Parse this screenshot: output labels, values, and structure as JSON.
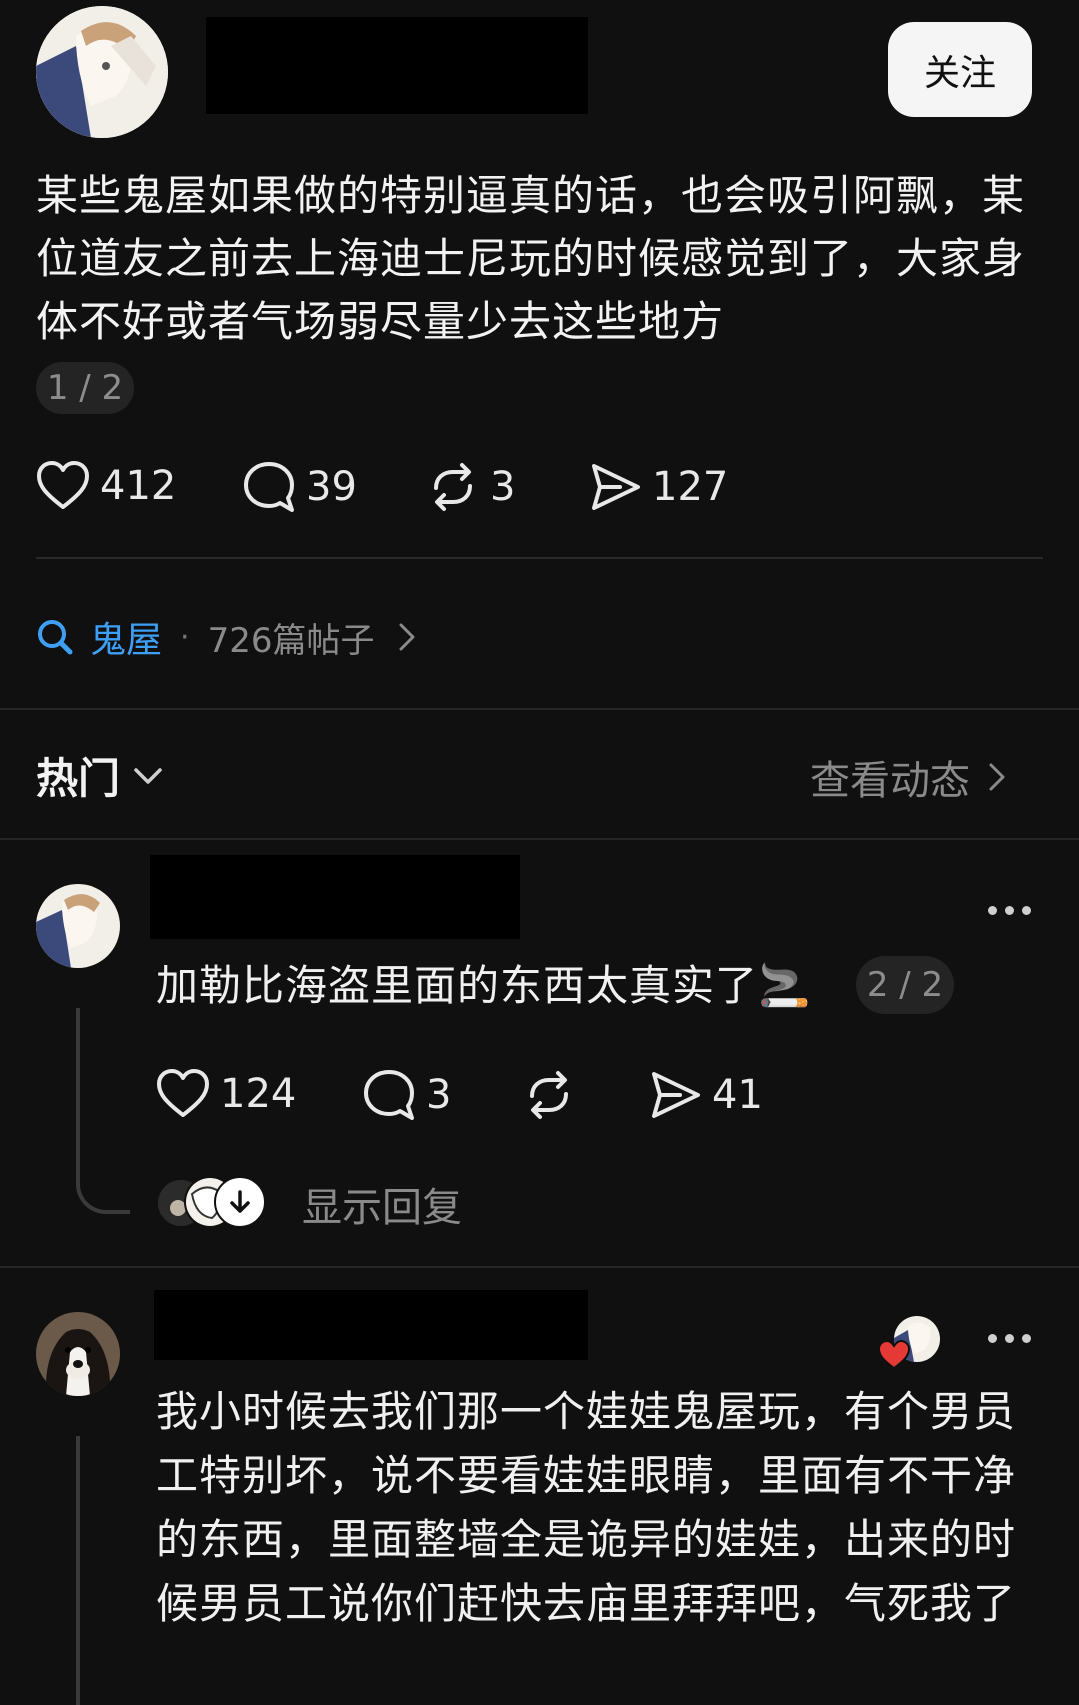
{
  "post": {
    "follow_label": "关注",
    "text": "某些鬼屋如果做的特别逼真的话，也会吸引阿飘，某位道友之前去上海迪士尼玩的时候感觉到了，大家身体不好或者气场弱尽量少去这些地方",
    "page_indicator": "1 / 2",
    "likes": "412",
    "comments": "39",
    "reposts": "3",
    "shares": "127"
  },
  "topic": {
    "name": "鬼屋",
    "separator": "·",
    "count": "726篇帖子"
  },
  "comments_header": {
    "sort_label": "热门",
    "view_activity": "查看动态"
  },
  "comments": [
    {
      "text": "加勒比海盗里面的东西太真实了🚬",
      "page_indicator": "2 / 2",
      "likes": "124",
      "comments": "3",
      "shares": "41",
      "show_replies": "显示回复"
    },
    {
      "text": "我小时候去我们那一个娃娃鬼屋玩，有个男员工特别坏，说不要看娃娃眼睛，里面有不干净的东西，里面整墙全是诡异的娃娃，出来的时候男员工说你们赶快去庙里拜拜吧，气死我了"
    }
  ],
  "colors": {
    "background": "#101010",
    "accent": "#3ea0f5",
    "like_heart": "#e53935"
  }
}
